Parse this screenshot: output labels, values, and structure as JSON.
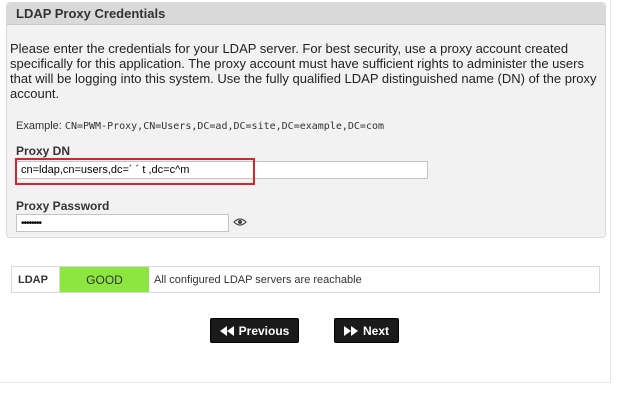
{
  "panel": {
    "title": "LDAP Proxy Credentials",
    "intro": "Please enter the credentials for your LDAP server. For best security, use a proxy account created specifically for this application. The proxy account must have sufficient rights to administer the users that will be logging into this system. Use the fully qualified LDAP distinguished name (DN) of the proxy account.",
    "example_label": "Example:",
    "example_value": "CN=PWM-Proxy,CN=Users,DC=ad,DC=site,DC=example,DC=com"
  },
  "proxy_dn": {
    "label": "Proxy DN",
    "value": "cn=ldap,cn=users,dc=´ ´ t      ,dc=c^m"
  },
  "proxy_password": {
    "label": "Proxy Password",
    "value": "••••••••"
  },
  "health": {
    "name": "LDAP",
    "status": "GOOD",
    "detail": "All configured LDAP servers are reachable",
    "status_color": "#8ce63f"
  },
  "buttons": {
    "previous": "Previous",
    "next": "Next"
  },
  "icons": {
    "eye": "eye-icon",
    "previous": "rewind-icon",
    "next": "fast-forward-icon"
  },
  "colors": {
    "highlight": "#d9232d"
  }
}
